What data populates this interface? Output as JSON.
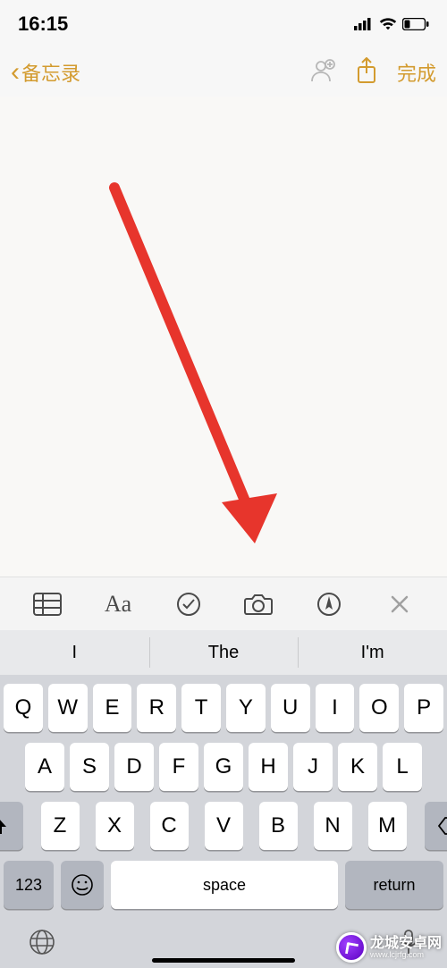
{
  "status": {
    "time": "16:15"
  },
  "nav": {
    "back_label": "备忘录",
    "done_label": "完成"
  },
  "toolbar": {
    "table_icon": "table-icon",
    "format_icon": "format-icon",
    "checklist_icon": "checklist-icon",
    "camera_icon": "camera-icon",
    "markup_icon": "markup-icon",
    "close_icon": "close-icon"
  },
  "suggestions": [
    "I",
    "The",
    "I'm"
  ],
  "keyboard": {
    "row1": [
      "Q",
      "W",
      "E",
      "R",
      "T",
      "Y",
      "U",
      "I",
      "O",
      "P"
    ],
    "row2": [
      "A",
      "S",
      "D",
      "F",
      "G",
      "H",
      "J",
      "K",
      "L"
    ],
    "row3": [
      "Z",
      "X",
      "C",
      "V",
      "B",
      "N",
      "M"
    ],
    "k123": "123",
    "space": "space",
    "return": "return"
  },
  "watermark": {
    "main": "龙城安卓网",
    "sub": "www.lcjrfg.com"
  },
  "arrow": {
    "color": "#e7352c"
  }
}
